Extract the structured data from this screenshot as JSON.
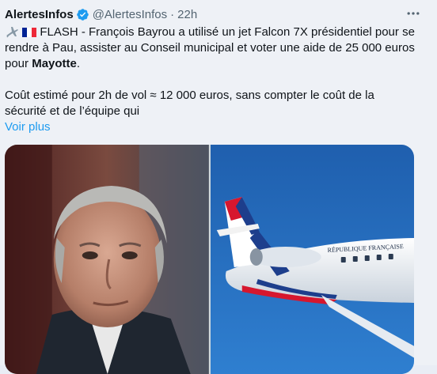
{
  "tweet": {
    "author_name": "AlertesInfos",
    "author_handle": "@AlertesInfos",
    "separator": "·",
    "time": "22h",
    "verified": true,
    "text": {
      "line1_prefix_icons": [
        "airplane-icon",
        "flag-france-icon"
      ],
      "para1_before_bold": "FLASH - François Bayrou a utilisé un jet Falcon 7X présidentiel pour se rendre à Pau, assister au Conseil municipal et voter une aide de 25 000 euros pour ",
      "para1_bold": "Mayotte",
      "para1_after_bold": ".",
      "para2": "Coût estimé pour 2h de vol ≈ 12 000 euros, sans compter le coût de la sécurité et de l’équipe qui",
      "show_more": "Voir plus"
    },
    "aircraft_livery_text": "RÉPUBLIQUE FRANÇAISE",
    "colors": {
      "link": "#1d9bf0",
      "verified": "#1d9bf0",
      "muted": "#536471",
      "background": "#eef1f6"
    }
  }
}
